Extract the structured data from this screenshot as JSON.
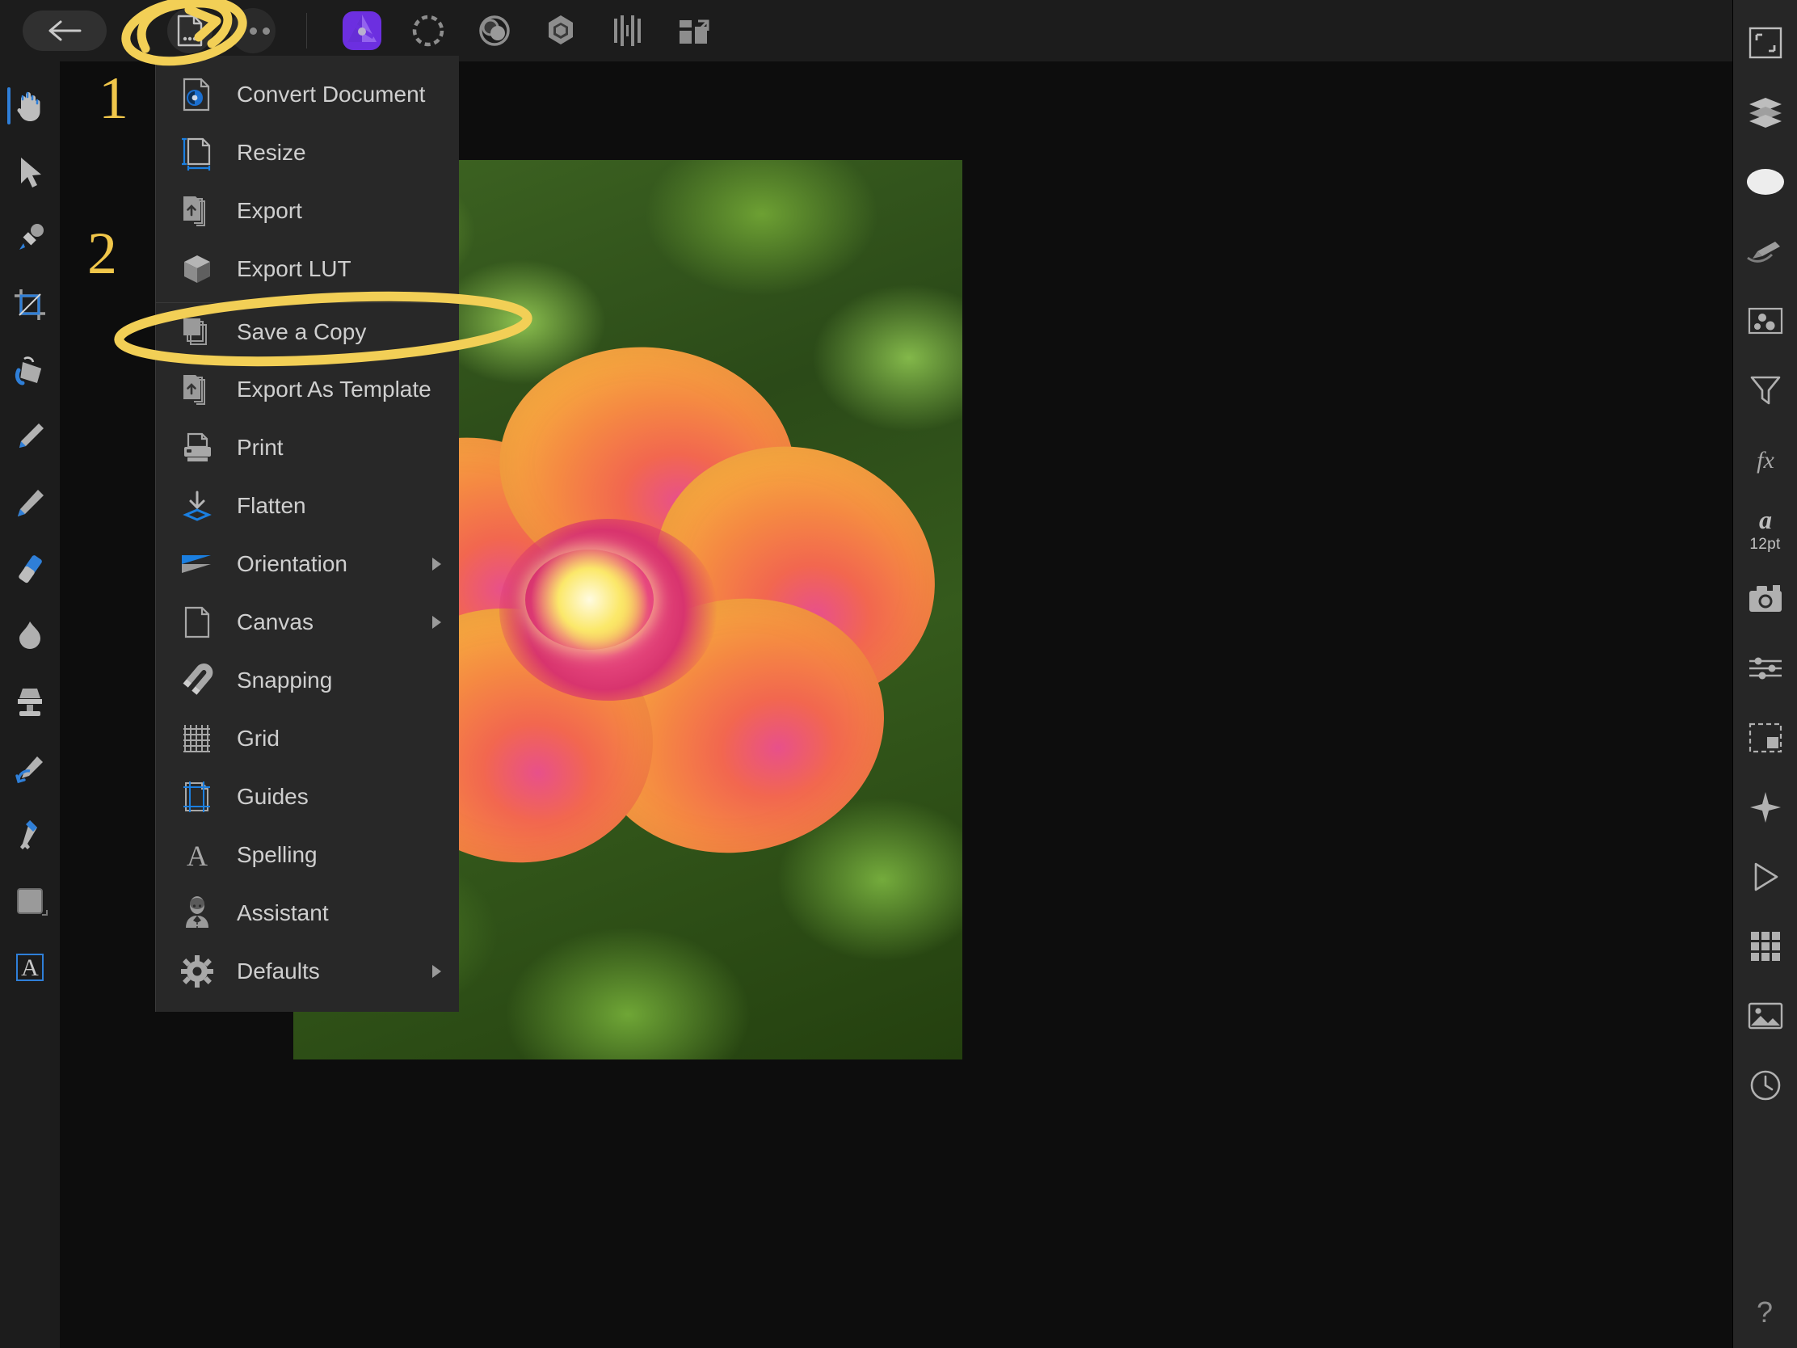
{
  "app": {
    "name": "Affinity Photo",
    "accent_blue": "#2f7fd8",
    "annotation_color": "#f2cf56",
    "menu_bg": "#282828",
    "topbar_bg": "#1c1c1c"
  },
  "topbar": {
    "back_label": "back-arrow",
    "buttons": [
      {
        "name": "document-menu-button",
        "icon": "document-dots-icon",
        "active": true
      },
      {
        "name": "more-options-button",
        "icon": "ellipsis-icon",
        "active": false
      }
    ],
    "personas": [
      {
        "name": "photo-persona",
        "icon": "affinity-photo-icon",
        "selected": true
      },
      {
        "name": "liquify-persona",
        "icon": "liquify-icon",
        "selected": false
      },
      {
        "name": "develop-persona",
        "icon": "develop-icon",
        "selected": false
      },
      {
        "name": "tone-mapping-persona",
        "icon": "tone-mapping-icon",
        "selected": false
      },
      {
        "name": "panorama-persona",
        "icon": "panorama-icon",
        "selected": false
      },
      {
        "name": "export-persona",
        "icon": "export-persona-icon",
        "selected": false
      }
    ]
  },
  "left_tools": [
    {
      "name": "view-tool",
      "icon": "hand-icon",
      "active": true
    },
    {
      "name": "move-tool",
      "icon": "arrow-cursor-icon",
      "active": false
    },
    {
      "name": "colour-picker-tool",
      "icon": "eyedropper-icon",
      "active": false
    },
    {
      "name": "crop-tool",
      "icon": "crop-icon",
      "active": false
    },
    {
      "name": "flood-fill-tool",
      "icon": "paint-bucket-icon",
      "active": false
    },
    {
      "name": "paint-brush-tool",
      "icon": "brush-icon",
      "active": false
    },
    {
      "name": "pixel-tool",
      "icon": "pencil-brush-icon",
      "active": false
    },
    {
      "name": "erase-brush-tool",
      "icon": "eraser-brush-icon",
      "active": false
    },
    {
      "name": "dodge-burn-tool",
      "icon": "burn-icon",
      "active": false
    },
    {
      "name": "clone-brush-tool",
      "icon": "clone-stamp-icon",
      "active": false
    },
    {
      "name": "undo-brush-tool",
      "icon": "undo-brush-icon",
      "active": false
    },
    {
      "name": "pen-tool",
      "icon": "pen-icon",
      "active": false
    },
    {
      "name": "colour-swatch",
      "icon": "colour-swatch-icon",
      "active": false
    },
    {
      "name": "artistic-text-tool",
      "icon": "text-a-icon",
      "active": false
    }
  ],
  "right_tools": [
    {
      "name": "studio-transform",
      "icon": "transform-frame-icon",
      "label": ""
    },
    {
      "name": "studio-layers",
      "icon": "layers-stack-icon",
      "label": ""
    },
    {
      "name": "studio-colour",
      "icon": "colour-ellipse-icon",
      "label": ""
    },
    {
      "name": "studio-brushes",
      "icon": "brush-stroke-icon",
      "label": ""
    },
    {
      "name": "studio-swatches",
      "icon": "swatches-icon",
      "label": ""
    },
    {
      "name": "studio-adjustments",
      "icon": "filter-funnel-icon",
      "label": ""
    },
    {
      "name": "studio-effects",
      "icon": "fx-icon",
      "label": "fx"
    },
    {
      "name": "studio-character",
      "icon": "character-a-icon",
      "label": "12pt"
    },
    {
      "name": "studio-stock",
      "icon": "camera-icon",
      "label": ""
    },
    {
      "name": "studio-adjustment-sliders",
      "icon": "sliders-icon",
      "label": ""
    },
    {
      "name": "studio-export-area",
      "icon": "export-area-icon",
      "label": ""
    },
    {
      "name": "studio-navigator",
      "icon": "navigator-icon",
      "label": ""
    },
    {
      "name": "studio-macro",
      "icon": "play-triangle-icon",
      "label": ""
    },
    {
      "name": "studio-grid",
      "icon": "grid-squares-icon",
      "label": ""
    },
    {
      "name": "studio-photo-library",
      "icon": "photo-icon",
      "label": ""
    },
    {
      "name": "studio-history",
      "icon": "clock-history-icon",
      "label": ""
    }
  ],
  "help_button": {
    "name": "help-button",
    "label": "?"
  },
  "document_menu": {
    "items": [
      {
        "label": "Convert Document",
        "icon": "convert-document-icon",
        "submenu": false,
        "separator_above": false
      },
      {
        "label": "Resize",
        "icon": "resize-document-icon",
        "submenu": false,
        "separator_above": false
      },
      {
        "label": "Export",
        "icon": "export-icon",
        "submenu": false,
        "separator_above": false
      },
      {
        "label": "Export LUT",
        "icon": "cube-lut-icon",
        "submenu": false,
        "separator_above": false
      },
      {
        "label": "Save a Copy",
        "icon": "save-copy-icon",
        "submenu": false,
        "separator_above": true
      },
      {
        "label": "Export As Template",
        "icon": "export-template-icon",
        "submenu": false,
        "separator_above": false
      },
      {
        "label": "Print",
        "icon": "printer-icon",
        "submenu": false,
        "separator_above": false
      },
      {
        "label": "Flatten",
        "icon": "flatten-icon",
        "submenu": false,
        "separator_above": false
      },
      {
        "label": "Orientation",
        "icon": "orientation-flag-icon",
        "submenu": true,
        "separator_above": false
      },
      {
        "label": "Canvas",
        "icon": "canvas-page-icon",
        "submenu": true,
        "separator_above": false
      },
      {
        "label": "Snapping",
        "icon": "magnet-icon",
        "submenu": false,
        "separator_above": false
      },
      {
        "label": "Grid",
        "icon": "grid-icon",
        "submenu": false,
        "separator_above": false
      },
      {
        "label": "Guides",
        "icon": "guides-icon",
        "submenu": false,
        "separator_above": false
      },
      {
        "label": "Spelling",
        "icon": "spelling-a-icon",
        "submenu": false,
        "separator_above": false
      },
      {
        "label": "Assistant",
        "icon": "assistant-person-icon",
        "submenu": false,
        "separator_above": false
      },
      {
        "label": "Defaults",
        "icon": "gear-icon",
        "submenu": true,
        "separator_above": false
      }
    ]
  },
  "annotations": {
    "step_one": "1",
    "step_two": "2",
    "circle_one_target": "document-menu-button",
    "circle_two_target": "Save a Copy"
  },
  "canvas": {
    "image_name": "hibiscus-flower-photo"
  }
}
